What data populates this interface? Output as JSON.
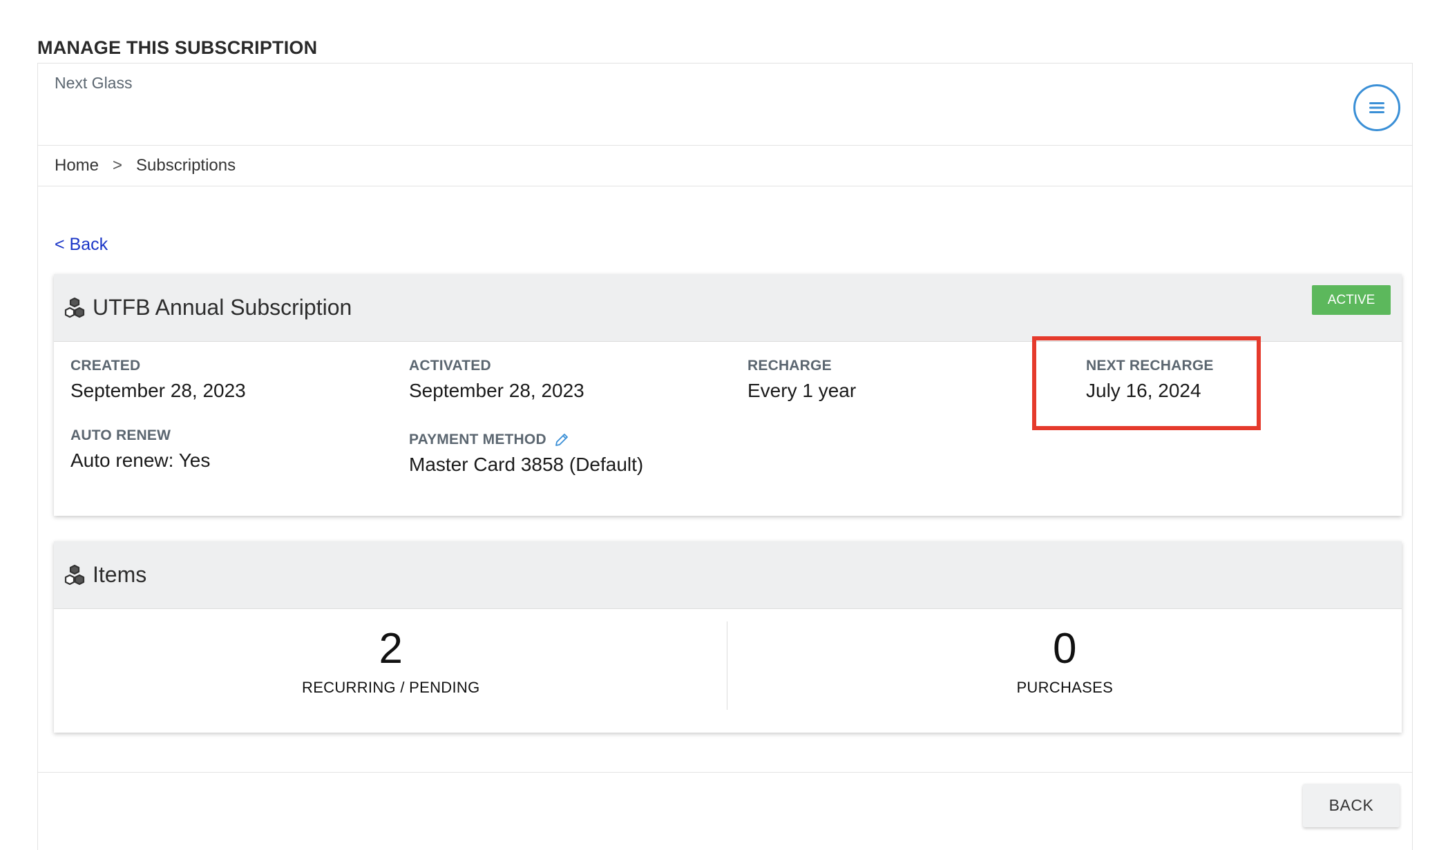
{
  "page": {
    "title": "MANAGE THIS SUBSCRIPTION"
  },
  "header": {
    "shop_name": "Next Glass",
    "menu_icon": "hamburger-menu-icon"
  },
  "breadcrumb": {
    "home": "Home",
    "separator": ">",
    "current": "Subscriptions"
  },
  "back_link": "< Back",
  "subscription": {
    "title": "UTFB Annual Subscription",
    "status": "ACTIVE",
    "status_color": "#5cb85c",
    "fields": {
      "created": {
        "label": "CREATED",
        "value": "September 28, 2023"
      },
      "activated": {
        "label": "ACTIVATED",
        "value": "September 28, 2023"
      },
      "recharge": {
        "label": "RECHARGE",
        "value": "Every 1 year"
      },
      "next_recharge": {
        "label": "NEXT RECHARGE",
        "value": "July 16, 2024"
      },
      "auto_renew": {
        "label": "AUTO RENEW",
        "value": "Auto renew: Yes"
      },
      "payment_method": {
        "label": "PAYMENT METHOD",
        "value": "Master Card 3858 (Default)"
      }
    },
    "highlight_color": "#e53a2c"
  },
  "items": {
    "title": "Items",
    "recurring": {
      "count": "2",
      "label": "RECURRING / PENDING"
    },
    "purchases": {
      "count": "0",
      "label": "PURCHASES"
    }
  },
  "footer": {
    "back_button": "BACK"
  },
  "colors": {
    "link": "#1a35c7",
    "accent": "#3a8fd6"
  }
}
